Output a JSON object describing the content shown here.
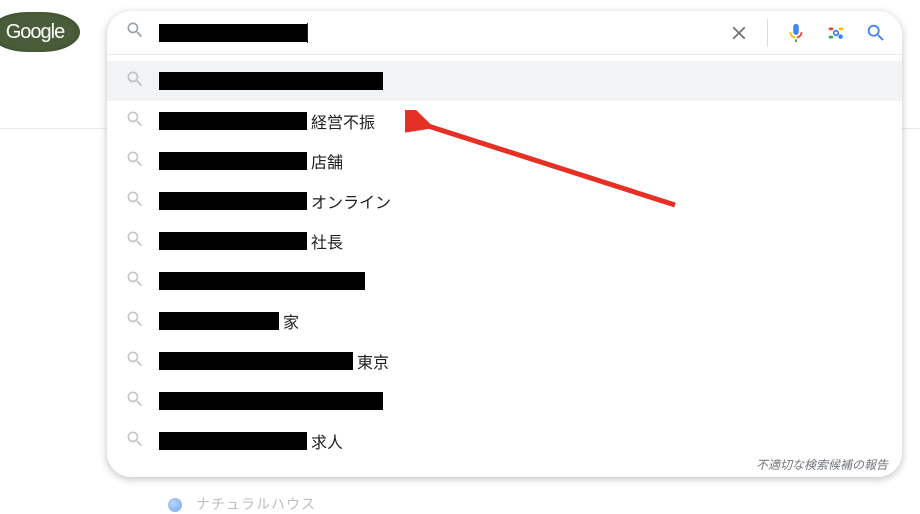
{
  "logo": {
    "text": "Google"
  },
  "search": {
    "input_value": "",
    "placeholder": "",
    "icons": {
      "clear": "clear-icon",
      "voice": "voice-icon",
      "lens": "lens-icon",
      "search": "search-icon"
    }
  },
  "suggestions": [
    {
      "redact_width": 224,
      "suffix": "",
      "highlighted": true
    },
    {
      "redact_width": 148,
      "suffix": "経営不振",
      "highlighted": false
    },
    {
      "redact_width": 148,
      "suffix": "店舗",
      "highlighted": false
    },
    {
      "redact_width": 148,
      "suffix": "オンライン",
      "highlighted": false
    },
    {
      "redact_width": 148,
      "suffix": "社長",
      "highlighted": false
    },
    {
      "redact_width": 206,
      "suffix": "",
      "highlighted": false
    },
    {
      "redact_width": 120,
      "suffix": "家",
      "highlighted": false
    },
    {
      "redact_width": 194,
      "suffix": "東京",
      "highlighted": false
    },
    {
      "redact_width": 224,
      "suffix": "",
      "highlighted": false
    },
    {
      "redact_width": 148,
      "suffix": "求人",
      "highlighted": false
    }
  ],
  "report_label": "不適切な検索候補の報告",
  "below_result": "ナチュラルハウス",
  "arrow_color": "#e63025"
}
